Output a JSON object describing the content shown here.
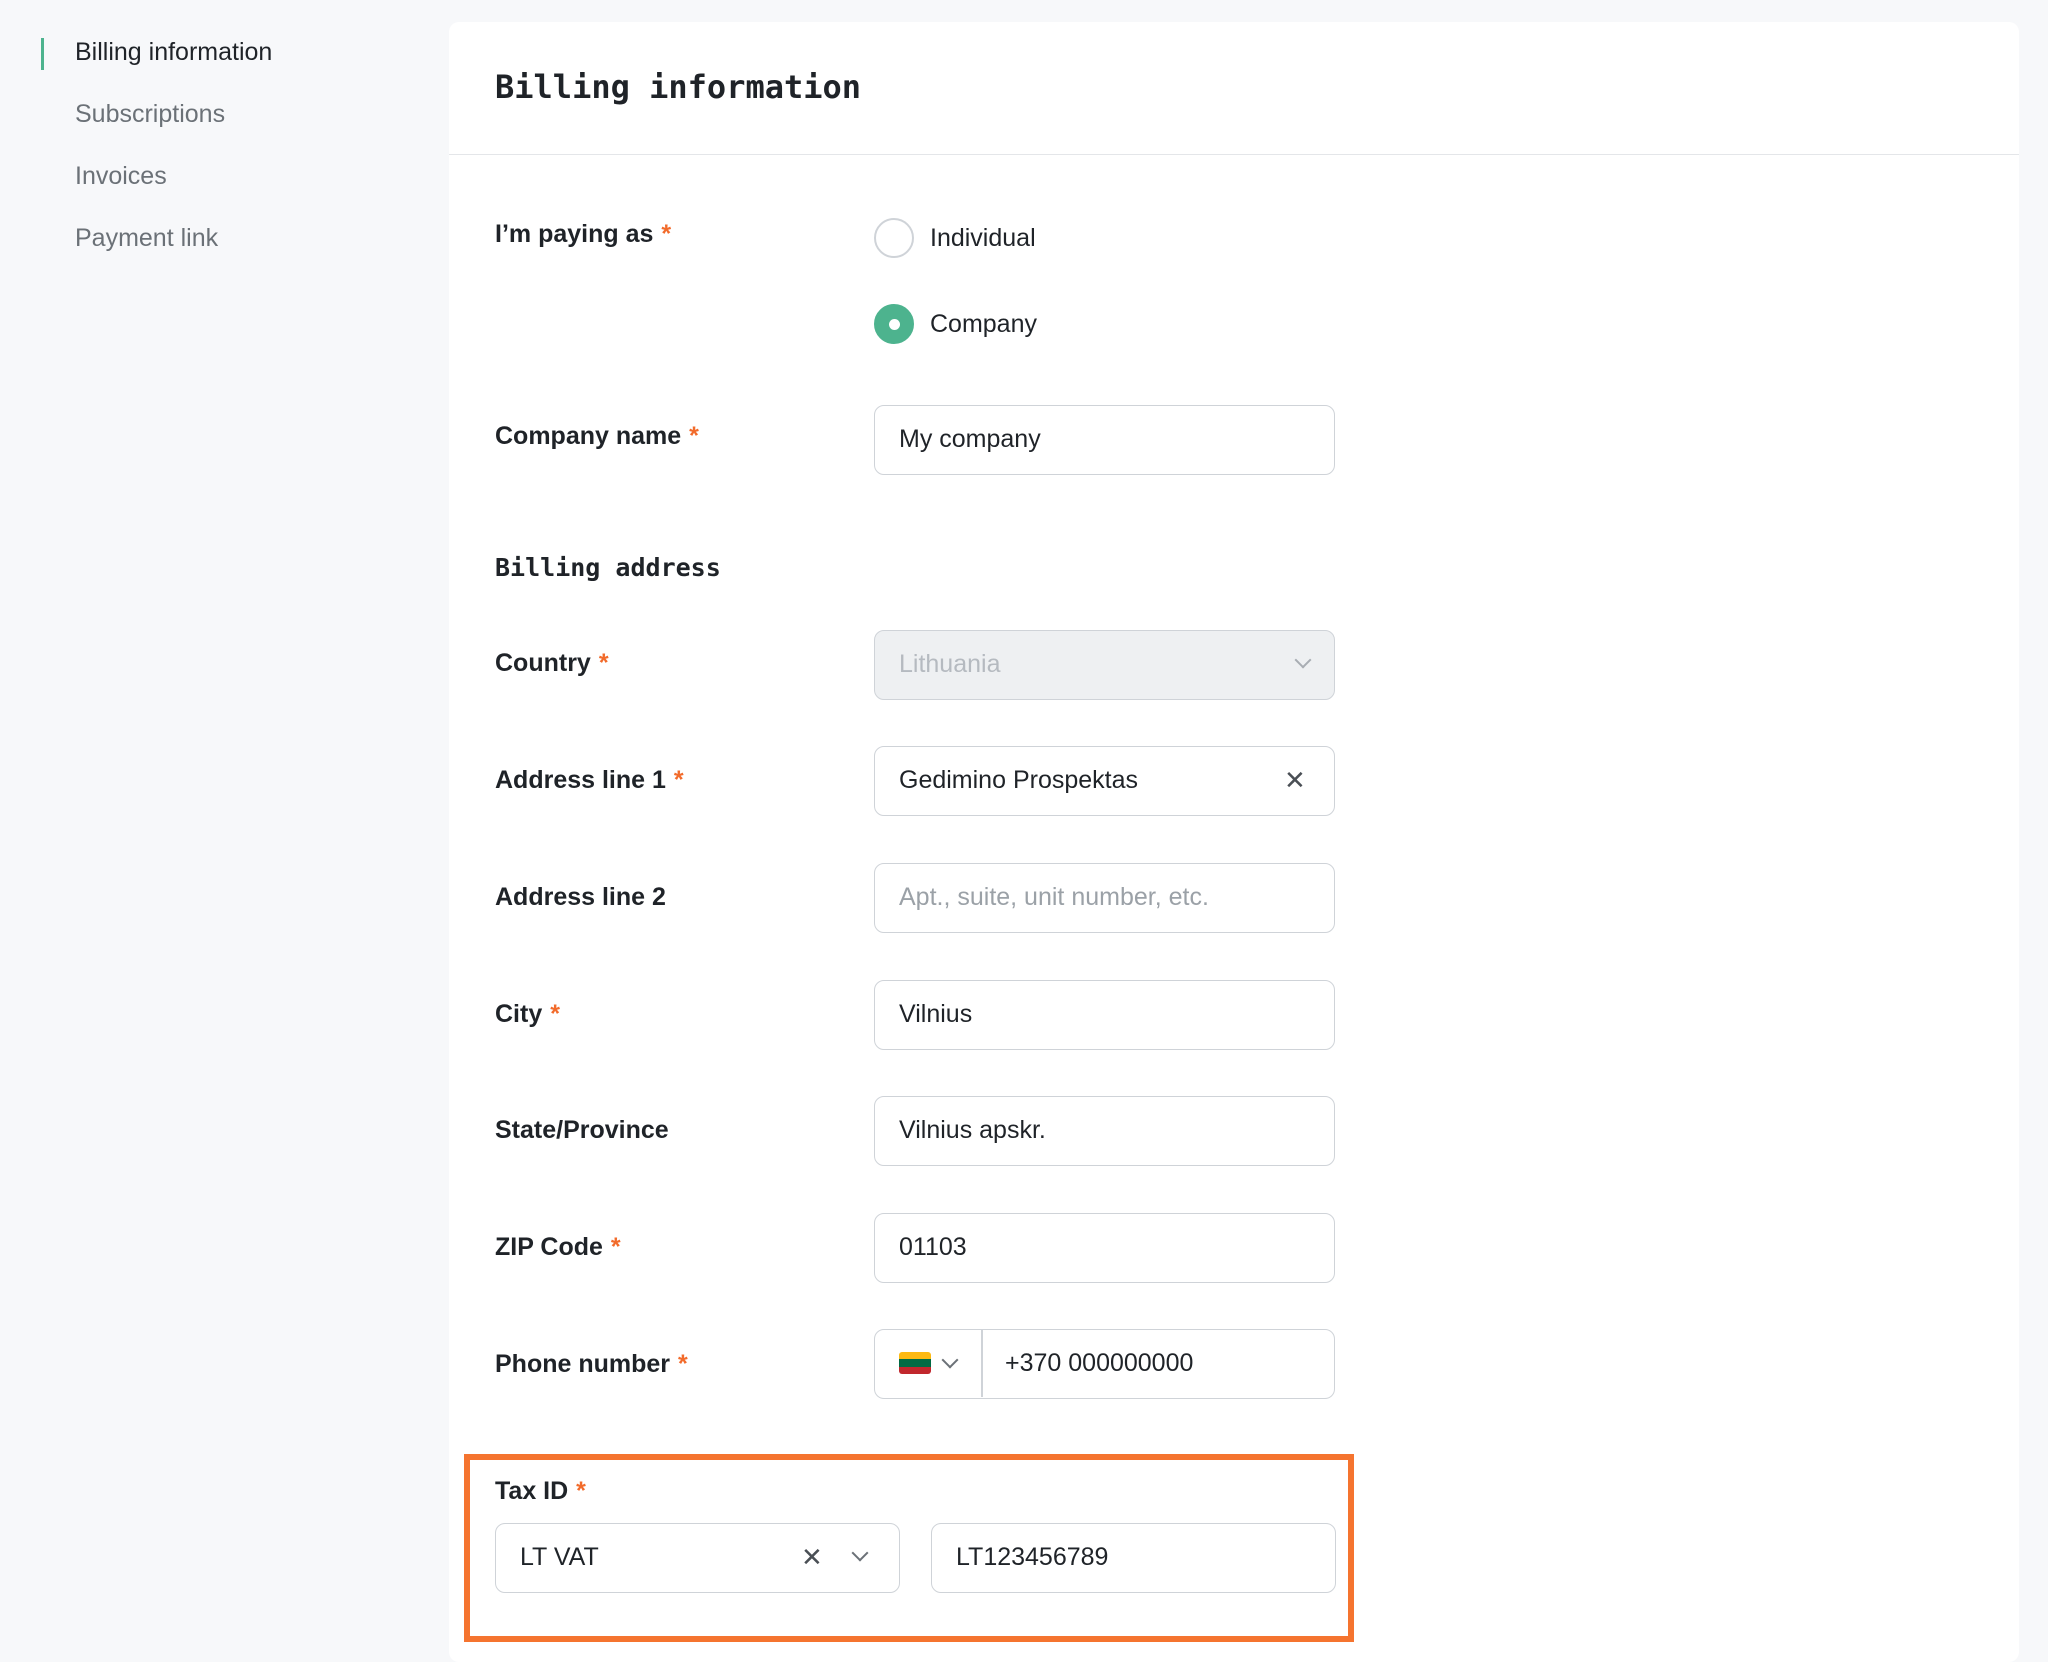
{
  "sidebar": {
    "items": [
      {
        "label": "Billing information",
        "active": true
      },
      {
        "label": "Subscriptions",
        "active": false
      },
      {
        "label": "Invoices",
        "active": false
      },
      {
        "label": "Payment link",
        "active": false
      }
    ]
  },
  "page": {
    "title": "Billing information",
    "required_marker": "*"
  },
  "form": {
    "paying_as": {
      "label": "I’m paying as",
      "options": [
        {
          "label": "Individual",
          "selected": false
        },
        {
          "label": "Company",
          "selected": true
        }
      ]
    },
    "company_name": {
      "label": "Company name",
      "value": "My company"
    },
    "billing_address_title": "Billing address",
    "country": {
      "label": "Country",
      "value": "Lithuania",
      "disabled": true
    },
    "address_line_1": {
      "label": "Address line 1",
      "value": "Gedimino Prospektas"
    },
    "address_line_2": {
      "label": "Address line 2",
      "value": "",
      "placeholder": "Apt., suite, unit number, etc."
    },
    "city": {
      "label": "City",
      "value": "Vilnius"
    },
    "state": {
      "label": "State/Province",
      "value": "Vilnius apskr."
    },
    "zip": {
      "label": "ZIP Code",
      "value": "01103"
    },
    "phone": {
      "label": "Phone number",
      "country_flag": "flag-lithuania-icon",
      "value": "+370 000000000"
    },
    "tax_id": {
      "label": "Tax ID",
      "type": "LT VAT",
      "value": "LT123456789"
    }
  },
  "colors": {
    "accent": "#4db38e",
    "required": "#f26b2b",
    "highlight": "#f5742f",
    "flag": [
      "#fdb913",
      "#006a44",
      "#c1272d"
    ]
  },
  "icons": {
    "clear": "close-icon",
    "dropdown": "chevron-down-icon"
  }
}
